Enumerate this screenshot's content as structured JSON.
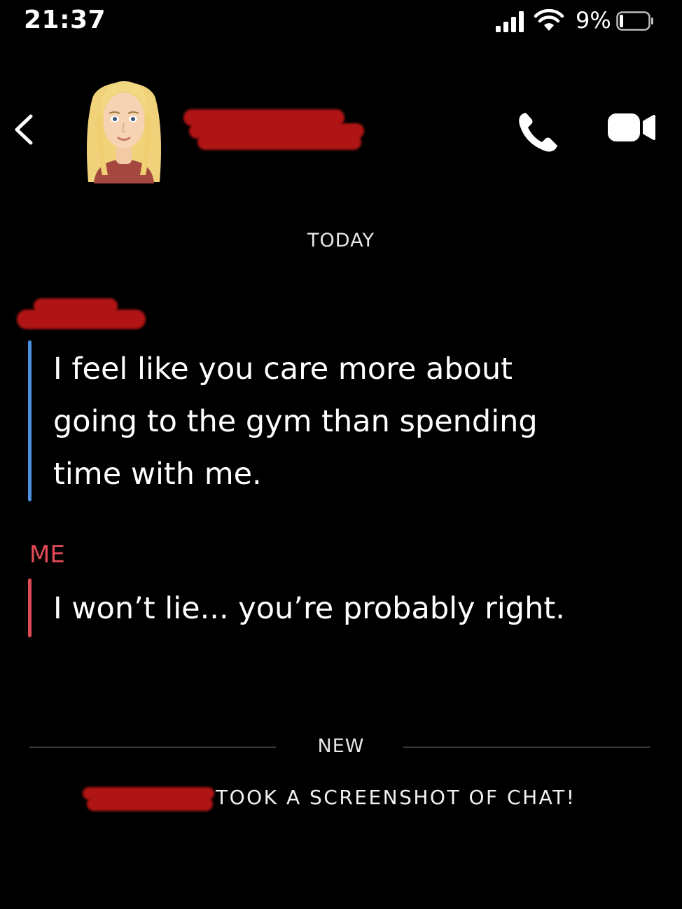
{
  "status_bar": {
    "time": "21:37",
    "battery_percent": "9%",
    "battery_level": 0.09
  },
  "header": {
    "contact_name_redacted": true,
    "icons": [
      "back-chevron-icon",
      "phone-icon",
      "video-camera-icon"
    ]
  },
  "chat": {
    "date_label": "TODAY",
    "messages": [
      {
        "sender_redacted": true,
        "accent": "#4a8fe0",
        "text": "I feel like you care more about going to the gym than spending time with me."
      },
      {
        "sender": "ME",
        "accent": "#e04a56",
        "text": "I won’t lie... you’re probably right."
      }
    ],
    "new_divider_label": "NEW",
    "screenshot_notice": "TOOK A SCREENSHOT OF CHAT!"
  },
  "colors": {
    "background": "#000000",
    "friend_accent": "#4a8fe0",
    "me_accent": "#e04a56",
    "redaction": "#b01414"
  }
}
